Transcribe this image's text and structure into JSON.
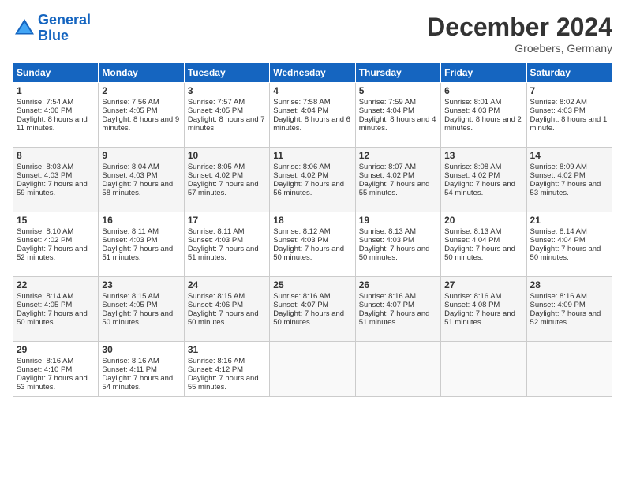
{
  "header": {
    "logo_line1": "General",
    "logo_line2": "Blue",
    "month_title": "December 2024",
    "location": "Groebers, Germany"
  },
  "days_of_week": [
    "Sunday",
    "Monday",
    "Tuesday",
    "Wednesday",
    "Thursday",
    "Friday",
    "Saturday"
  ],
  "weeks": [
    [
      {
        "day": "1",
        "info": "Sunrise: 7:54 AM\nSunset: 4:06 PM\nDaylight: 8 hours and 11 minutes."
      },
      {
        "day": "2",
        "info": "Sunrise: 7:56 AM\nSunset: 4:05 PM\nDaylight: 8 hours and 9 minutes."
      },
      {
        "day": "3",
        "info": "Sunrise: 7:57 AM\nSunset: 4:05 PM\nDaylight: 8 hours and 7 minutes."
      },
      {
        "day": "4",
        "info": "Sunrise: 7:58 AM\nSunset: 4:04 PM\nDaylight: 8 hours and 6 minutes."
      },
      {
        "day": "5",
        "info": "Sunrise: 7:59 AM\nSunset: 4:04 PM\nDaylight: 8 hours and 4 minutes."
      },
      {
        "day": "6",
        "info": "Sunrise: 8:01 AM\nSunset: 4:03 PM\nDaylight: 8 hours and 2 minutes."
      },
      {
        "day": "7",
        "info": "Sunrise: 8:02 AM\nSunset: 4:03 PM\nDaylight: 8 hours and 1 minute."
      }
    ],
    [
      {
        "day": "8",
        "info": "Sunrise: 8:03 AM\nSunset: 4:03 PM\nDaylight: 7 hours and 59 minutes."
      },
      {
        "day": "9",
        "info": "Sunrise: 8:04 AM\nSunset: 4:03 PM\nDaylight: 7 hours and 58 minutes."
      },
      {
        "day": "10",
        "info": "Sunrise: 8:05 AM\nSunset: 4:02 PM\nDaylight: 7 hours and 57 minutes."
      },
      {
        "day": "11",
        "info": "Sunrise: 8:06 AM\nSunset: 4:02 PM\nDaylight: 7 hours and 56 minutes."
      },
      {
        "day": "12",
        "info": "Sunrise: 8:07 AM\nSunset: 4:02 PM\nDaylight: 7 hours and 55 minutes."
      },
      {
        "day": "13",
        "info": "Sunrise: 8:08 AM\nSunset: 4:02 PM\nDaylight: 7 hours and 54 minutes."
      },
      {
        "day": "14",
        "info": "Sunrise: 8:09 AM\nSunset: 4:02 PM\nDaylight: 7 hours and 53 minutes."
      }
    ],
    [
      {
        "day": "15",
        "info": "Sunrise: 8:10 AM\nSunset: 4:02 PM\nDaylight: 7 hours and 52 minutes."
      },
      {
        "day": "16",
        "info": "Sunrise: 8:11 AM\nSunset: 4:03 PM\nDaylight: 7 hours and 51 minutes."
      },
      {
        "day": "17",
        "info": "Sunrise: 8:11 AM\nSunset: 4:03 PM\nDaylight: 7 hours and 51 minutes."
      },
      {
        "day": "18",
        "info": "Sunrise: 8:12 AM\nSunset: 4:03 PM\nDaylight: 7 hours and 50 minutes."
      },
      {
        "day": "19",
        "info": "Sunrise: 8:13 AM\nSunset: 4:03 PM\nDaylight: 7 hours and 50 minutes."
      },
      {
        "day": "20",
        "info": "Sunrise: 8:13 AM\nSunset: 4:04 PM\nDaylight: 7 hours and 50 minutes."
      },
      {
        "day": "21",
        "info": "Sunrise: 8:14 AM\nSunset: 4:04 PM\nDaylight: 7 hours and 50 minutes."
      }
    ],
    [
      {
        "day": "22",
        "info": "Sunrise: 8:14 AM\nSunset: 4:05 PM\nDaylight: 7 hours and 50 minutes."
      },
      {
        "day": "23",
        "info": "Sunrise: 8:15 AM\nSunset: 4:05 PM\nDaylight: 7 hours and 50 minutes."
      },
      {
        "day": "24",
        "info": "Sunrise: 8:15 AM\nSunset: 4:06 PM\nDaylight: 7 hours and 50 minutes."
      },
      {
        "day": "25",
        "info": "Sunrise: 8:16 AM\nSunset: 4:07 PM\nDaylight: 7 hours and 50 minutes."
      },
      {
        "day": "26",
        "info": "Sunrise: 8:16 AM\nSunset: 4:07 PM\nDaylight: 7 hours and 51 minutes."
      },
      {
        "day": "27",
        "info": "Sunrise: 8:16 AM\nSunset: 4:08 PM\nDaylight: 7 hours and 51 minutes."
      },
      {
        "day": "28",
        "info": "Sunrise: 8:16 AM\nSunset: 4:09 PM\nDaylight: 7 hours and 52 minutes."
      }
    ],
    [
      {
        "day": "29",
        "info": "Sunrise: 8:16 AM\nSunset: 4:10 PM\nDaylight: 7 hours and 53 minutes."
      },
      {
        "day": "30",
        "info": "Sunrise: 8:16 AM\nSunset: 4:11 PM\nDaylight: 7 hours and 54 minutes."
      },
      {
        "day": "31",
        "info": "Sunrise: 8:16 AM\nSunset: 4:12 PM\nDaylight: 7 hours and 55 minutes."
      },
      null,
      null,
      null,
      null
    ]
  ]
}
